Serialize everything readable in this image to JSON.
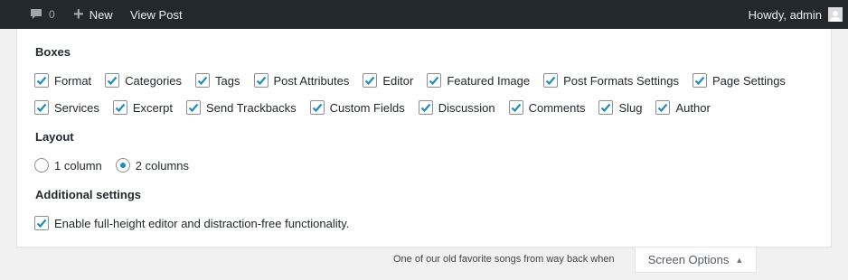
{
  "adminbar": {
    "comments_count": "0",
    "new_label": "New",
    "view_post_label": "View Post",
    "howdy_label": "Howdy, admin"
  },
  "screen_options": {
    "boxes_legend": "Boxes",
    "boxes_row1": [
      {
        "label": "Format",
        "checked": true
      },
      {
        "label": "Categories",
        "checked": true
      },
      {
        "label": "Tags",
        "checked": true
      },
      {
        "label": "Post Attributes",
        "checked": true
      },
      {
        "label": "Editor",
        "checked": true
      },
      {
        "label": "Featured Image",
        "checked": true
      },
      {
        "label": "Post Formats Settings",
        "checked": true
      },
      {
        "label": "Page Settings",
        "checked": true
      }
    ],
    "boxes_row2": [
      {
        "label": "Services",
        "checked": true
      },
      {
        "label": "Excerpt",
        "checked": true
      },
      {
        "label": "Send Trackbacks",
        "checked": true
      },
      {
        "label": "Custom Fields",
        "checked": true
      },
      {
        "label": "Discussion",
        "checked": true
      },
      {
        "label": "Comments",
        "checked": true
      },
      {
        "label": "Slug",
        "checked": true
      },
      {
        "label": "Author",
        "checked": true
      }
    ],
    "layout_legend": "Layout",
    "layout_options": [
      {
        "label": "1 column",
        "selected": false
      },
      {
        "label": "2 columns",
        "selected": true
      }
    ],
    "additional_legend": "Additional settings",
    "additional_option": {
      "label": "Enable full-height editor and distraction-free functionality.",
      "checked": true
    }
  },
  "footer_note": "One of our old favorite songs from way back when",
  "screen_options_tab": "Screen Options",
  "colors": {
    "adminbar_bg": "#23282d",
    "check_color": "#1e8cbe"
  }
}
